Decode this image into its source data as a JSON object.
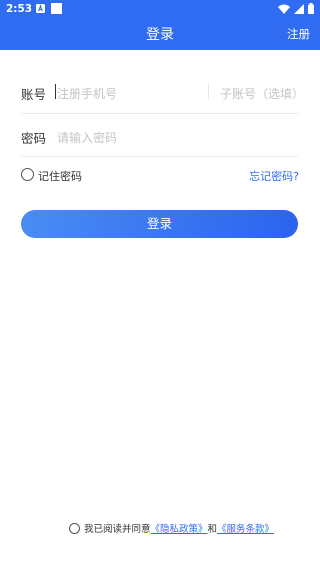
{
  "status_bar": {
    "time": "2:53"
  },
  "header": {
    "title": "登录",
    "register_label": "注册"
  },
  "form": {
    "account_label": "账号",
    "account_placeholder": "注册手机号",
    "subaccount_placeholder": "子账号（选填）",
    "password_label": "密码",
    "password_placeholder": "请输入密码",
    "remember_label": "记住密码",
    "forgot_label": "忘记密码?",
    "login_button": "登录"
  },
  "agreement": {
    "prefix": "我已阅读并同意",
    "privacy_link": "《隐私政策》",
    "and": "和",
    "terms_link": "《服务条款》"
  },
  "colors": {
    "primary": "#2f6cf2",
    "button_gradient_start": "#4a8cf5",
    "button_gradient_end": "#2c63ee"
  }
}
